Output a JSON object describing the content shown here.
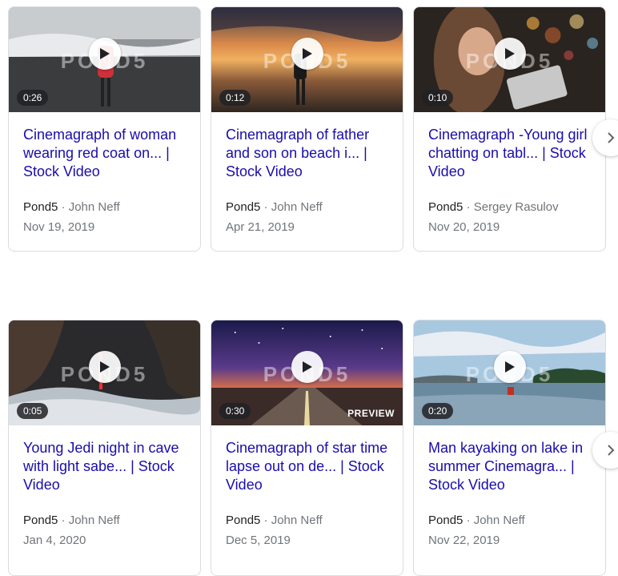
{
  "row1": {
    "cards": [
      {
        "duration": "0:26",
        "title": "Cinemagraph of woman wearing red coat on... | Stock Video",
        "site": "Pond5",
        "author": "John Neff",
        "date": "Nov 19, 2019",
        "watermark": "POND5"
      },
      {
        "duration": "0:12",
        "title": "Cinemagraph of father and son on beach i... | Stock Video",
        "site": "Pond5",
        "author": "John Neff",
        "date": "Apr 21, 2019",
        "watermark": "POND5"
      },
      {
        "duration": "0:10",
        "title": "Cinemagraph -Young girl chatting on tabl... | Stock Video",
        "site": "Pond5",
        "author": "Sergey Rasulov",
        "date": "Nov 20, 2019",
        "watermark": "POND5"
      }
    ]
  },
  "row2": {
    "cards": [
      {
        "duration": "0:05",
        "title": "Young Jedi night in cave with light sabe... | Stock Video",
        "site": "Pond5",
        "author": "John Neff",
        "date": "Jan 4, 2020",
        "watermark": "POND5"
      },
      {
        "duration": "0:30",
        "title": "Cinemagraph of star time lapse out on de... | Stock Video",
        "site": "Pond5",
        "author": "John Neff",
        "date": "Dec 5, 2019",
        "watermark": "POND5",
        "badge": "PREVIEW"
      },
      {
        "duration": "0:20",
        "title": "Man kayaking on lake in summer Cinemagra... | Stock Video",
        "site": "Pond5",
        "author": "John Neff",
        "date": "Nov 22, 2019",
        "watermark": "POND5"
      }
    ]
  },
  "separator": " · ",
  "icons": {
    "play": "play-icon",
    "next": "chevron-right-icon"
  },
  "colors": {
    "link": "#1a0dab",
    "meta": "#70757a",
    "border": "#dadce0"
  }
}
